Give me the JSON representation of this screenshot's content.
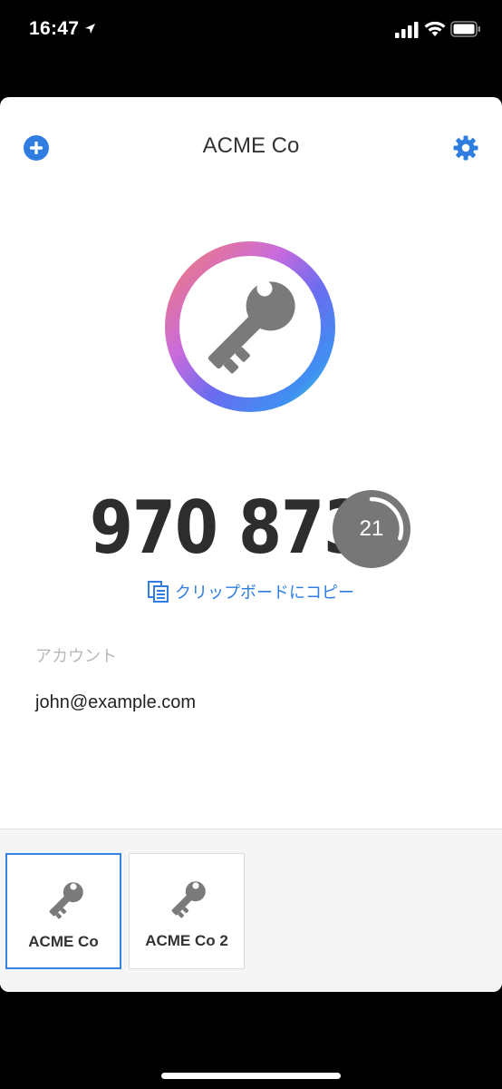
{
  "status_bar": {
    "time": "16:47"
  },
  "header": {
    "title": "ACME Co"
  },
  "token": {
    "code": "970 873",
    "seconds_remaining": "21",
    "period_seconds": 30
  },
  "copy": {
    "label": "クリップボードにコピー"
  },
  "account": {
    "label": "アカウント",
    "value": "john@example.com"
  },
  "accounts_list": [
    {
      "label": "ACME Co",
      "selected": true
    },
    {
      "label": "ACME Co 2",
      "selected": false
    }
  ],
  "colors": {
    "accent": "#2f7de1",
    "timer": "#777777",
    "key": "#7a7a7a"
  }
}
